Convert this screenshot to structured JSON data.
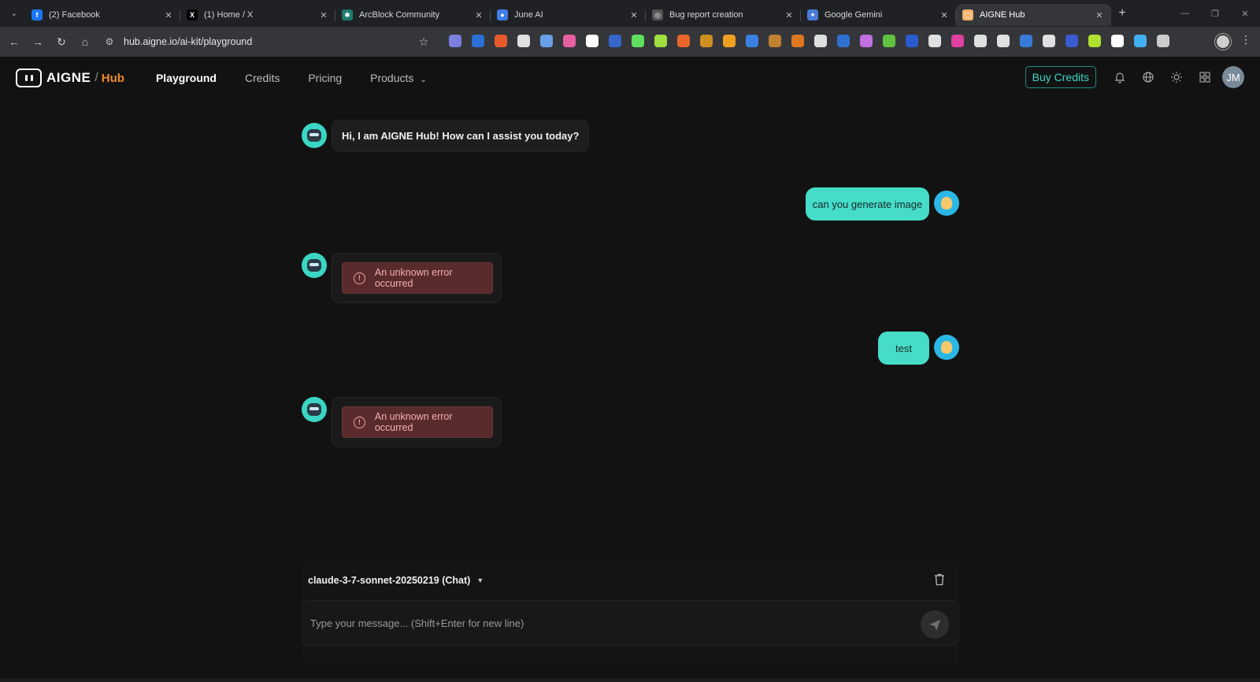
{
  "browser": {
    "tabs": [
      {
        "label": "(2) Facebook",
        "color": "#1877f2",
        "glyph": "f"
      },
      {
        "label": "(1) Home / X",
        "color": "#000000",
        "glyph": "X"
      },
      {
        "label": "ArcBlock Community",
        "color": "#1f7a6f",
        "glyph": "✱"
      },
      {
        "label": "June AI",
        "color": "#3f7de8",
        "glyph": "●"
      },
      {
        "label": "Bug report creation",
        "color": "#555555",
        "glyph": "◎"
      },
      {
        "label": "Google Gemini",
        "color": "#4a7bd6",
        "glyph": "✦"
      },
      {
        "label": "AIGNE Hub",
        "color": "#f5b26b",
        "glyph": "▢"
      }
    ],
    "url": "hub.aigne.io/ai-kit/playground",
    "extension_colors": [
      "#7b7fe0",
      "#2c6fd6",
      "#e85a2c",
      "#e0e0e0",
      "#6aa0e8",
      "#e860a0",
      "#ffffff",
      "#3566c9",
      "#5ee05e",
      "#a0e040",
      "#e8662c",
      "#d09020",
      "#f0a020",
      "#3a80e0",
      "#c08030",
      "#e07820",
      "#e0e0e0",
      "#3070d0",
      "#c070e0",
      "#60c040",
      "#2a5ad0",
      "#e0e0e0",
      "#e040a0",
      "#e0e0e0",
      "#e0e0e0",
      "#3a7ad8",
      "#e0e0e0",
      "#3a5ad0",
      "#b0e030",
      "#ffffff",
      "#40b0f0",
      "#cccccc"
    ]
  },
  "header": {
    "logo_text": "AIGNE",
    "logo_sub": "Hub",
    "nav": [
      {
        "label": "Playground",
        "active": true
      },
      {
        "label": "Credits",
        "active": false
      },
      {
        "label": "Pricing",
        "active": false
      },
      {
        "label": "Products",
        "active": false
      }
    ],
    "buy_label": "Buy Credits",
    "avatar_initials": "JM"
  },
  "chat": {
    "messages": [
      {
        "role": "assistant",
        "text": "Hi, I am AIGNE Hub! How can I assist you today?"
      },
      {
        "role": "user",
        "text": "can you generate image"
      },
      {
        "role": "assistant",
        "error": true,
        "text": "An unknown error occurred"
      },
      {
        "role": "user",
        "text": "test"
      },
      {
        "role": "assistant",
        "error": true,
        "text": "An unknown error occurred"
      }
    ]
  },
  "composer": {
    "model": "claude-3-7-sonnet-20250219 (Chat)",
    "placeholder": "Type your message... (Shift+Enter for new line)"
  },
  "colors": {
    "accent": "#45dcc8",
    "brand_orange": "#f08a2c",
    "error_bg": "#5a2b2c",
    "error_text": "#f2b1ae"
  }
}
